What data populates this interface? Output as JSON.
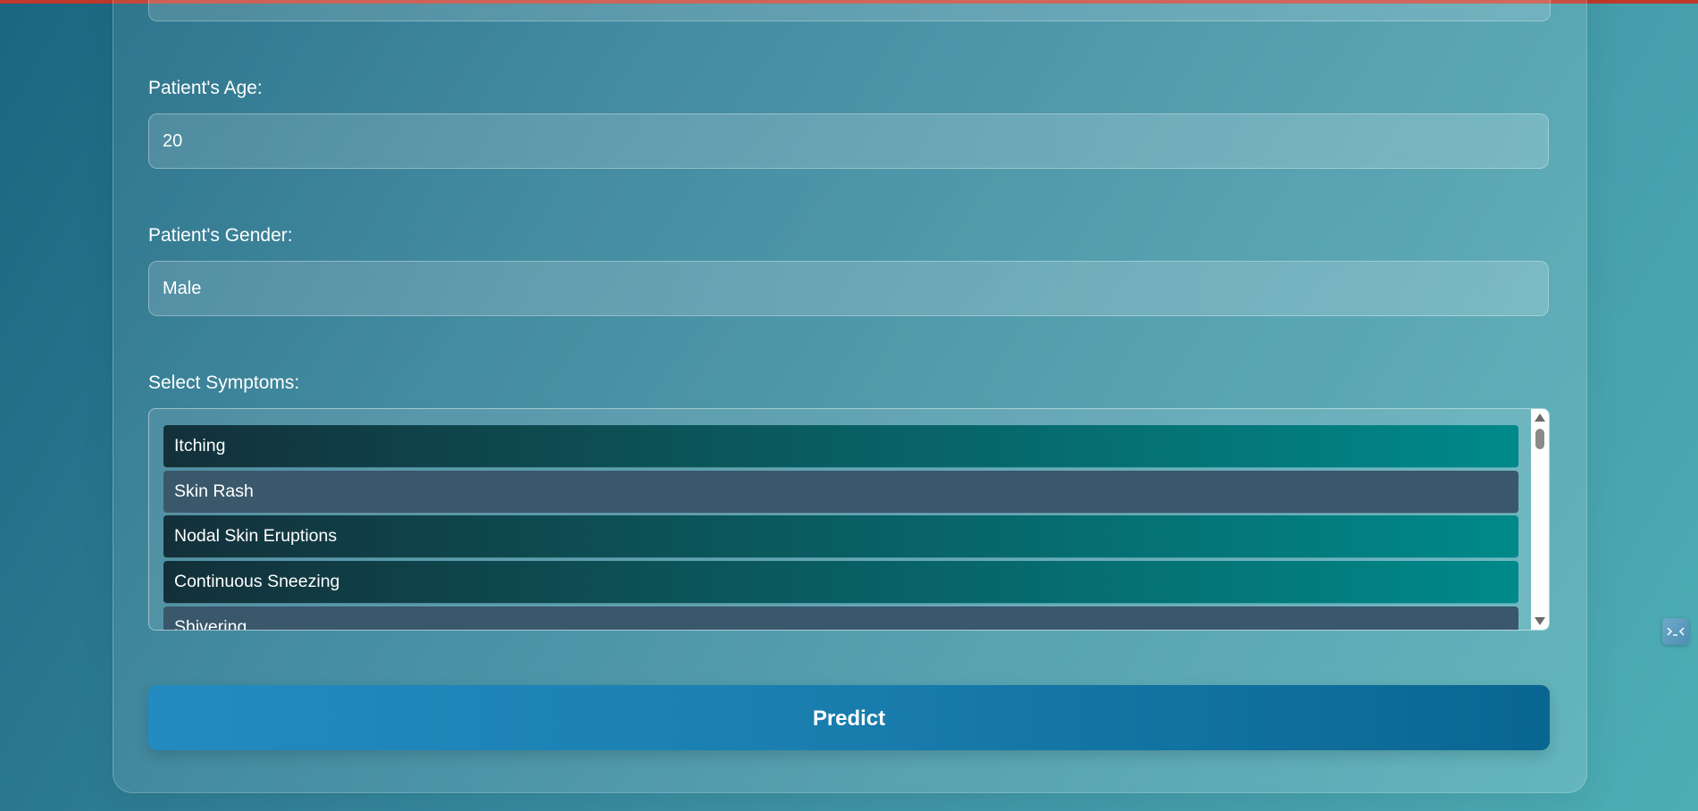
{
  "form": {
    "age": {
      "label": "Patient's Age:",
      "value": "20"
    },
    "gender": {
      "label": "Patient's Gender:",
      "value": "Male"
    },
    "symptoms": {
      "label": "Select Symptoms:",
      "options": [
        {
          "label": "Itching",
          "style": "teal"
        },
        {
          "label": "Skin Rash",
          "style": "slate"
        },
        {
          "label": "Nodal Skin Eruptions",
          "style": "teal"
        },
        {
          "label": "Continuous Sneezing",
          "style": "teal"
        },
        {
          "label": "Shivering",
          "style": "slate"
        }
      ]
    },
    "predict_label": "Predict"
  },
  "colors": {
    "page_gradient_start": "#1a6680",
    "page_gradient_end": "#4daeb5",
    "option_teal_start": "#13303a",
    "option_teal_end": "#00898a",
    "option_slate": "#3a576b",
    "button_start": "#238bc0",
    "button_end": "#0a6691",
    "top_bar": "#c0392b"
  },
  "icons": {
    "extension": "terminal-icon"
  }
}
